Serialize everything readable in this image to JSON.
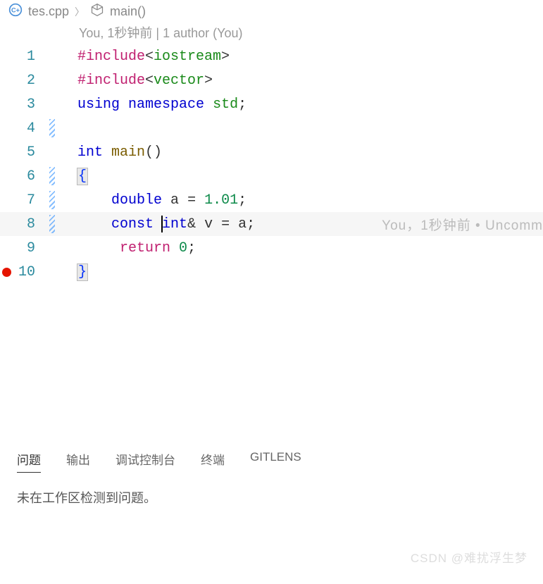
{
  "breadcrumb": {
    "file_name": "tes.cpp",
    "symbol_name": "main()"
  },
  "codelens": {
    "text": "You, 1秒钟前 | 1 author (You)"
  },
  "breakpoint_line": 10,
  "current_line": 8,
  "lines": [
    {
      "n": "1",
      "fold": false,
      "tokens": [
        [
          "preproc",
          "#include"
        ],
        [
          "bracket",
          "<"
        ],
        [
          "header",
          "iostream"
        ],
        [
          "bracket",
          ">"
        ]
      ]
    },
    {
      "n": "2",
      "fold": false,
      "tokens": [
        [
          "preproc",
          "#include"
        ],
        [
          "bracket",
          "<"
        ],
        [
          "header",
          "vector"
        ],
        [
          "bracket",
          ">"
        ]
      ]
    },
    {
      "n": "3",
      "fold": false,
      "tokens": [
        [
          "keyword",
          "using"
        ],
        [
          "text",
          " "
        ],
        [
          "keyword",
          "namespace"
        ],
        [
          "text",
          " "
        ],
        [
          "namespace",
          "std"
        ],
        [
          "punct",
          ";"
        ]
      ]
    },
    {
      "n": "4",
      "fold": true,
      "tokens": []
    },
    {
      "n": "5",
      "fold": false,
      "tokens": [
        [
          "type",
          "int"
        ],
        [
          "text",
          " "
        ],
        [
          "func",
          "main"
        ],
        [
          "punct",
          "()"
        ]
      ]
    },
    {
      "n": "6",
      "fold": true,
      "tokens": [
        [
          "braceboxed",
          "{"
        ]
      ]
    },
    {
      "n": "7",
      "fold": true,
      "tokens": [
        [
          "text",
          "    "
        ],
        [
          "type",
          "double"
        ],
        [
          "text",
          " "
        ],
        [
          "var",
          "a"
        ],
        [
          "text",
          " "
        ],
        [
          "op",
          "="
        ],
        [
          "text",
          " "
        ],
        [
          "num",
          "1.01"
        ],
        [
          "punct",
          ";"
        ]
      ]
    },
    {
      "n": "8",
      "fold": true,
      "tokens": [
        [
          "text",
          "    "
        ],
        [
          "keyword",
          "const"
        ],
        [
          "text",
          " "
        ],
        [
          "cursor",
          ""
        ],
        [
          "type",
          "int"
        ],
        [
          "op",
          "&"
        ],
        [
          "text",
          " "
        ],
        [
          "var",
          "v"
        ],
        [
          "text",
          " "
        ],
        [
          "op",
          "="
        ],
        [
          "text",
          " "
        ],
        [
          "var",
          "a"
        ],
        [
          "punct",
          ";"
        ]
      ]
    },
    {
      "n": "9",
      "fold": false,
      "tokens": [
        [
          "text",
          "     "
        ],
        [
          "return",
          "return"
        ],
        [
          "text",
          " "
        ],
        [
          "num",
          "0"
        ],
        [
          "punct",
          ";"
        ]
      ]
    },
    {
      "n": "10",
      "fold": false,
      "tokens": [
        [
          "braceboxed",
          "}"
        ]
      ]
    }
  ],
  "inline_blame": "You，1秒钟前 • Uncomm",
  "panel": {
    "tabs": [
      "问题",
      "输出",
      "调试控制台",
      "终端",
      "GITLENS"
    ],
    "active_tab": 0,
    "body": "未在工作区检测到问题。"
  },
  "watermark": "CSDN @难扰浮生梦"
}
